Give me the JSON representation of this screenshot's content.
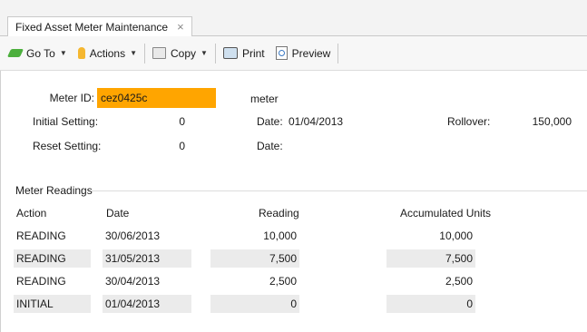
{
  "tab": {
    "title": "Fixed Asset Meter Maintenance",
    "close": "×"
  },
  "toolbar": {
    "goto": "Go To",
    "actions": "Actions",
    "copy": "Copy",
    "print": "Print",
    "preview": "Preview"
  },
  "form": {
    "meter_id_label": "Meter ID:",
    "meter_id_value": "cez0425c",
    "meter_desc": "meter",
    "initial_label": "Initial Setting:",
    "initial_value": "0",
    "initial_date_label": "Date:",
    "initial_date_value": "01/04/2013",
    "rollover_label": "Rollover:",
    "rollover_value": "150,000",
    "reset_label": "Reset Setting:",
    "reset_value": "0",
    "reset_date_label": "Date:",
    "highlight_color": "#ffa500"
  },
  "readings": {
    "section_title": "Meter Readings",
    "headers": [
      "Action",
      "Date",
      "Reading",
      "Accumulated Units"
    ],
    "rows": [
      {
        "action": "READING",
        "date": "30/06/2013",
        "reading": "10,000",
        "accumulated": "10,000"
      },
      {
        "action": "READING",
        "date": "31/05/2013",
        "reading": "7,500",
        "accumulated": "7,500"
      },
      {
        "action": "READING",
        "date": "30/04/2013",
        "reading": "2,500",
        "accumulated": "2,500"
      },
      {
        "action": "INITIAL",
        "date": "01/04/2013",
        "reading": "0",
        "accumulated": "0"
      }
    ]
  }
}
